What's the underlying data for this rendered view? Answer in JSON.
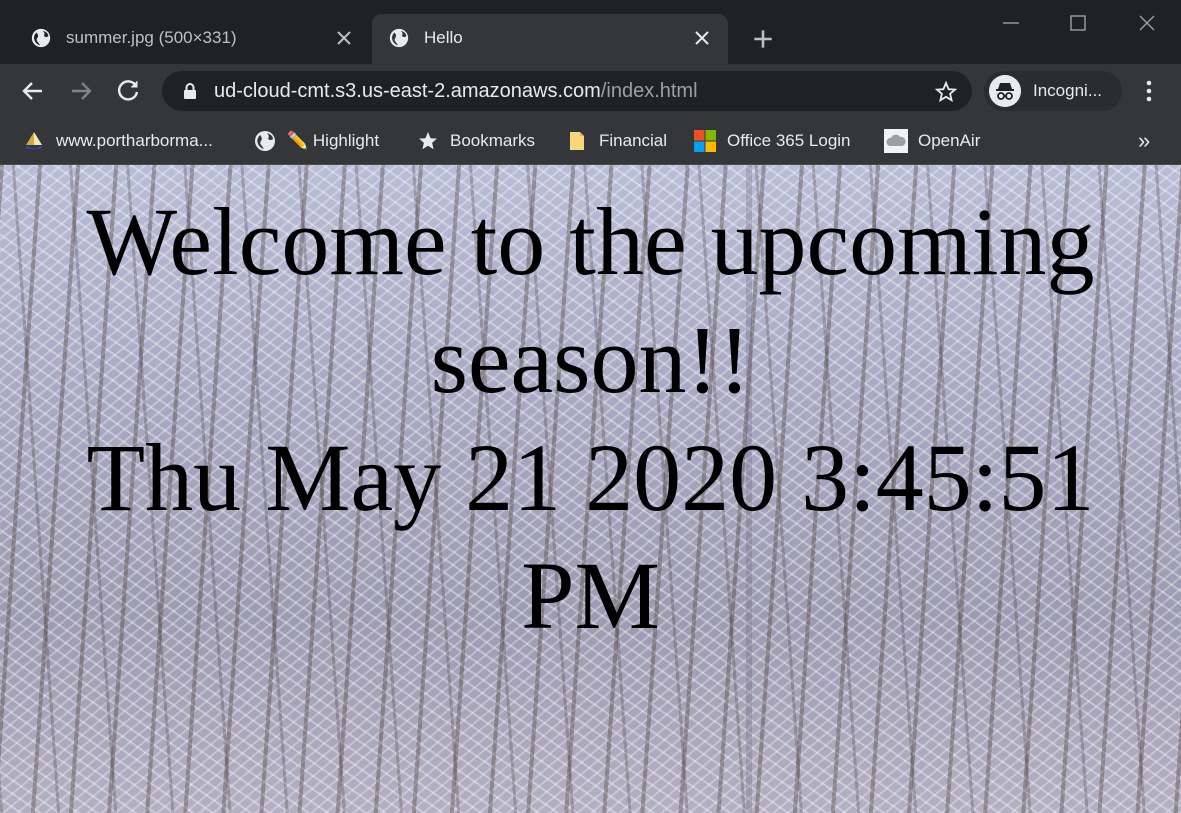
{
  "tabs": [
    {
      "title": "summer.jpg (500×331)",
      "active": false
    },
    {
      "title": "Hello",
      "active": true
    }
  ],
  "toolbar": {
    "url_host": "ud-cloud-cmt.s3.us-east-2.amazonaws.com",
    "url_path": "/index.html",
    "profile_label": "Incogni..."
  },
  "bookmarks": [
    {
      "label": "www.portharborma...",
      "icon": "ship-icon"
    },
    {
      "label": "✏️ Highlight",
      "icon": "globe-icon"
    },
    {
      "label": "Bookmarks",
      "icon": "star-icon"
    },
    {
      "label": "Financial",
      "icon": "folder-icon"
    },
    {
      "label": "Office 365 Login",
      "icon": "office-icon"
    },
    {
      "label": "OpenAir",
      "icon": "cloud-icon"
    }
  ],
  "bookmarks_more": "»",
  "page": {
    "line1": "Welcome to the upcoming",
    "line2": "season!!",
    "line3": "Thu May 21 2020 3:45:51",
    "line4": "PM"
  },
  "colors": {
    "frame": "#202124",
    "toolbar": "#35363a",
    "text": "#e8eaed"
  }
}
